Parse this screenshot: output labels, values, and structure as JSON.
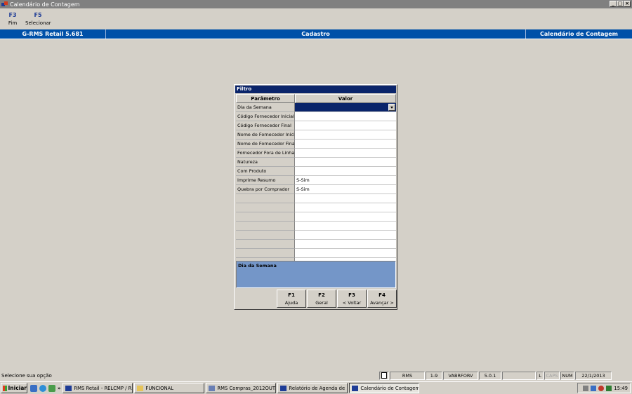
{
  "window": {
    "title": "Calendário de Contagem",
    "buttons": [
      "_",
      "□",
      "×"
    ]
  },
  "fkeys": [
    {
      "key": "F3",
      "label": "Fim"
    },
    {
      "key": "F5",
      "label": "Selecionar"
    }
  ],
  "header": {
    "left": "G-RMS Retail 5.681",
    "center": "Cadastro",
    "right": "Calendário de Contagem"
  },
  "dialog": {
    "title": "Filtro",
    "columns": {
      "param": "Parâmetro",
      "value": "Valor"
    },
    "rows": [
      {
        "param": "Dia da Semana",
        "value": ""
      },
      {
        "param": "Código Fornecedor Inicial",
        "value": ""
      },
      {
        "param": "Código Fornecedor Final",
        "value": ""
      },
      {
        "param": "Nome do Fornecedor Inicial",
        "value": ""
      },
      {
        "param": "Nome do Fornecedor Final",
        "value": ""
      },
      {
        "param": "Fornecedor Fora de Linha",
        "value": ""
      },
      {
        "param": "Natureza",
        "value": ""
      },
      {
        "param": "Com Produto",
        "value": ""
      },
      {
        "param": "Imprime Resumo",
        "value": "S-Sim"
      },
      {
        "param": "Quebra por Comprador",
        "value": "S-Sim"
      },
      {
        "param": "",
        "value": ""
      },
      {
        "param": "",
        "value": ""
      },
      {
        "param": "",
        "value": ""
      },
      {
        "param": "",
        "value": ""
      },
      {
        "param": "",
        "value": ""
      },
      {
        "param": "",
        "value": ""
      },
      {
        "param": "",
        "value": ""
      },
      {
        "param": "",
        "value": ""
      }
    ],
    "description": "Dia da Semana",
    "buttons": [
      {
        "key": "F1",
        "label": "Ajuda"
      },
      {
        "key": "F2",
        "label": "Geral"
      },
      {
        "key": "F3",
        "label": "< Voltar"
      },
      {
        "key": "F4",
        "label": "Avançar >"
      }
    ]
  },
  "statusbar": {
    "message": "Selecione sua opção",
    "cells": [
      "RMS",
      "1-9",
      "VABRFORV",
      "5.0.1",
      "",
      "L",
      "CAPS",
      "NUM",
      "22/1/2013"
    ]
  },
  "taskbar": {
    "start": "Iniciar",
    "tasks": [
      "RMS Retail - RELCMP / R...",
      "FUNCIONAL",
      "RMS Compras_2012OUT...",
      "Relatório de Agenda de ...",
      "Calendário de Contagem"
    ],
    "clock": "15:49"
  },
  "colors": {
    "header_blue": "#0050a8",
    "dialog_title": "#0a246a",
    "description_bg": "#7496c8"
  }
}
